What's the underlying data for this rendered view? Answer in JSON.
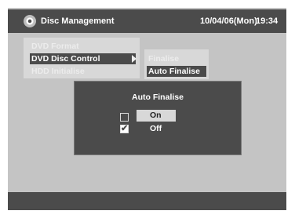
{
  "header": {
    "title": "Disc Management",
    "date": "10/04/06(Mon)",
    "time": "19:34",
    "icon": "disc-icon"
  },
  "menu": {
    "items": [
      {
        "label": "DVD Format"
      },
      {
        "label": "DVD Disc Control"
      },
      {
        "label": "HDD Initialise"
      }
    ]
  },
  "submenu": {
    "items": [
      {
        "label": "Finalise"
      },
      {
        "label": "Auto Finalise"
      }
    ]
  },
  "dialog": {
    "title": "Auto Finalise",
    "options": [
      {
        "label": "On",
        "checked": false,
        "selected": true
      },
      {
        "label": "Off",
        "checked": true,
        "selected": false
      }
    ],
    "check_glyph": "✔"
  },
  "colors": {
    "panel": "#4b4b4b",
    "background": "#c4c4c4",
    "highlight": "#d8d8d8"
  }
}
